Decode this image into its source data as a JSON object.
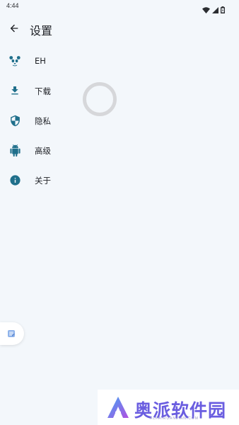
{
  "status_bar": {
    "time": "4:44",
    "icons": [
      "wifi-icon",
      "signal-icon",
      "battery-icon"
    ]
  },
  "app_bar": {
    "title": "设置",
    "back_icon": "arrow-back-icon"
  },
  "settings": {
    "items": [
      {
        "label": "EH",
        "icon": "panda-icon"
      },
      {
        "label": "下载",
        "icon": "download-icon"
      },
      {
        "label": "隐私",
        "icon": "shield-icon"
      },
      {
        "label": "高级",
        "icon": "android-icon"
      },
      {
        "label": "关于",
        "icon": "info-icon"
      }
    ]
  },
  "loading": {
    "icon": "loading-spinner"
  },
  "side_tab": {
    "icon": "note-icon"
  },
  "watermark": {
    "text": "奥派软件园",
    "subtext": "ALPAIRUANJIAN.COM"
  },
  "colors": {
    "background": "#f3f7fb",
    "icon_primary": "#1f6f8b",
    "spinner": "#d6d7da",
    "watermark": "#6a5de0"
  }
}
